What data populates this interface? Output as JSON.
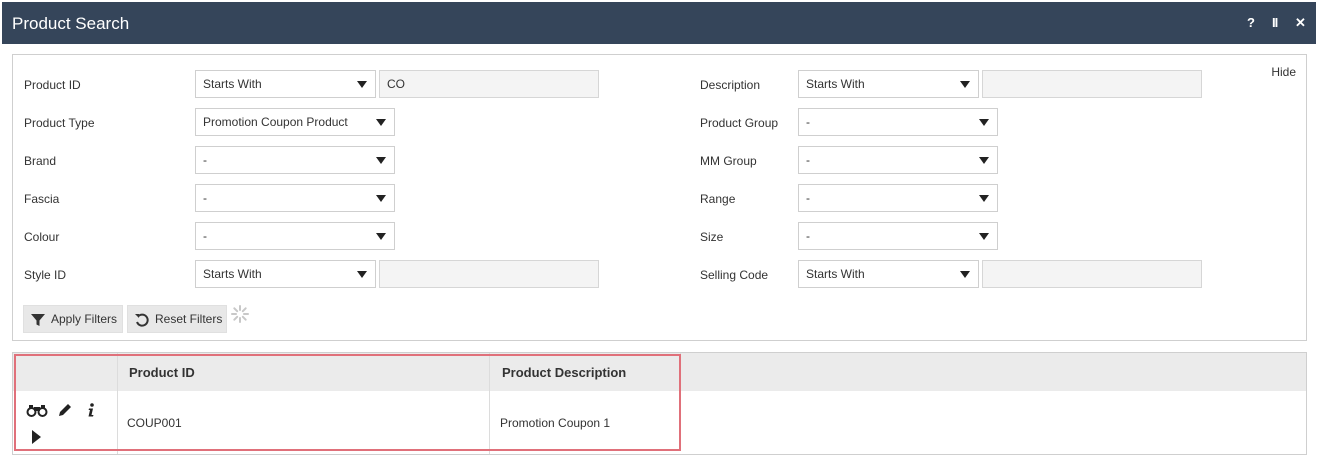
{
  "window": {
    "title": "Product Search",
    "help_label": "?",
    "pause_label": "II",
    "close_label": "✕"
  },
  "filters": {
    "hide_label": "Hide",
    "product_id": {
      "label": "Product ID",
      "mode": "Starts With",
      "value": "CO"
    },
    "product_type": {
      "label": "Product Type",
      "value": "Promotion Coupon Product"
    },
    "brand": {
      "label": "Brand",
      "value": "-"
    },
    "fascia": {
      "label": "Fascia",
      "value": "-"
    },
    "colour": {
      "label": "Colour",
      "value": "-"
    },
    "style_id": {
      "label": "Style ID",
      "mode": "Starts With",
      "value": ""
    },
    "description": {
      "label": "Description",
      "mode": "Starts With",
      "value": ""
    },
    "product_group": {
      "label": "Product Group",
      "value": "-"
    },
    "mm_group": {
      "label": "MM Group",
      "value": "-"
    },
    "range": {
      "label": "Range",
      "value": "-"
    },
    "size": {
      "label": "Size",
      "value": "-"
    },
    "selling_code": {
      "label": "Selling Code",
      "mode": "Starts With",
      "value": ""
    },
    "apply_label": "Apply Filters",
    "reset_label": "Reset Filters"
  },
  "results": {
    "columns": [
      "",
      "Product ID",
      "Product Description"
    ],
    "rows": [
      {
        "product_id": "COUP001",
        "product_description": "Promotion Coupon 1"
      }
    ],
    "row_actions": [
      "binoculars-icon",
      "pencil-icon",
      "info-icon",
      "expand-arrow-icon"
    ]
  },
  "colors": {
    "titlebar": "#35455a",
    "highlight_border": "#e0707a",
    "header_bg": "#ebebeb"
  }
}
